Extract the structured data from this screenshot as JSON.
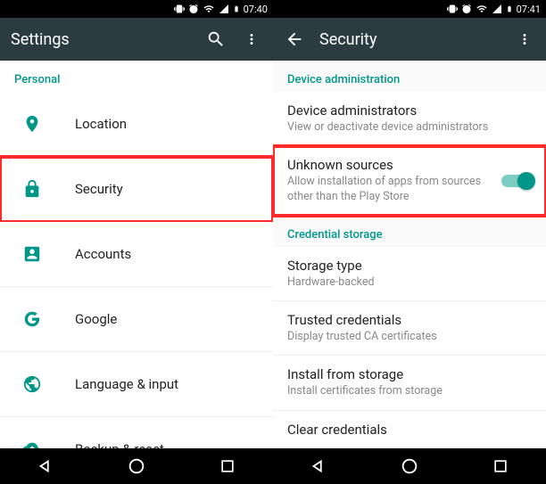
{
  "left": {
    "status": {
      "time": "07:40"
    },
    "appbar": {
      "title": "Settings"
    },
    "section": "Personal",
    "items": [
      {
        "label": "Location"
      },
      {
        "label": "Security"
      },
      {
        "label": "Accounts"
      },
      {
        "label": "Google"
      },
      {
        "label": "Language & input"
      },
      {
        "label": "Backup & reset"
      }
    ]
  },
  "right": {
    "status": {
      "time": "07:41"
    },
    "appbar": {
      "title": "Security"
    },
    "sections": {
      "device": "Device administration",
      "cred": "Credential storage"
    },
    "rows": {
      "admins": {
        "title": "Device administrators",
        "sub": "View or deactivate device administrators"
      },
      "unknown": {
        "title": "Unknown sources",
        "sub": "Allow installation of apps from sources other than the Play Store"
      },
      "storage_type": {
        "title": "Storage type",
        "sub": "Hardware-backed"
      },
      "trusted": {
        "title": "Trusted credentials",
        "sub": "Display trusted CA certificates"
      },
      "install": {
        "title": "Install from storage",
        "sub": "Install certificates from storage"
      },
      "clear": {
        "title": "Clear credentials"
      }
    }
  }
}
